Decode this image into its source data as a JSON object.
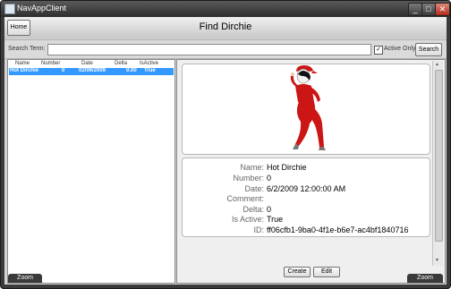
{
  "window": {
    "title": "NavAppClient"
  },
  "header": {
    "home_label": "Home",
    "page_title": "Find Dirchie"
  },
  "search": {
    "label": "Search Term:",
    "value": "",
    "active_only_label": "Active Only",
    "active_only_checked": true,
    "check_mark": "✓",
    "button_label": "Search"
  },
  "grid": {
    "columns": [
      "Name",
      "Number",
      "Date",
      "Delta",
      "IsActive"
    ],
    "rows": [
      {
        "name": "Hot Dirchie",
        "number": "0",
        "date": "02/06/2009",
        "delta": "0.00",
        "is_active": "True"
      }
    ],
    "selected_color": "#3399ff"
  },
  "details": {
    "labels": {
      "name": "Name:",
      "number": "Number:",
      "date": "Date:",
      "comment": "Comment:",
      "delta": "Delta:",
      "is_active": "Is Active:",
      "id": "ID:"
    },
    "values": {
      "name": "Hot Dirchie",
      "number": "0",
      "date": "6/2/2009 12:00:00 AM",
      "comment": "",
      "delta": "0",
      "is_active": "True",
      "id": "ff06cfb1-9ba0-4f1e-b6e7-ac4bf1840716"
    }
  },
  "actions": {
    "create_label": "Create",
    "edit_label": "Edit"
  },
  "zoom": {
    "left_label": "Zoom",
    "right_label": "Zoom"
  },
  "icons": {
    "minimize": "minimize-icon",
    "maximize": "maximize-icon",
    "close": "close-icon",
    "app": "app-window-icon"
  }
}
